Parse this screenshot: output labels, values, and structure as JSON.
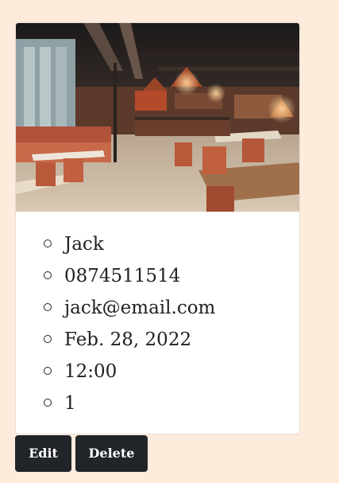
{
  "reservation": {
    "image_alt": "restaurant-interior-photo",
    "name": "Jack",
    "phone": "0874511514",
    "email": "jack@email.com",
    "date": "Feb. 28, 2022",
    "time": "12:00",
    "guests": "1"
  },
  "actions": {
    "edit_label": "Edit",
    "delete_label": "Delete"
  },
  "colors": {
    "page_background": "#fdebdb",
    "button_background": "#212529",
    "button_text": "#ffffff"
  }
}
